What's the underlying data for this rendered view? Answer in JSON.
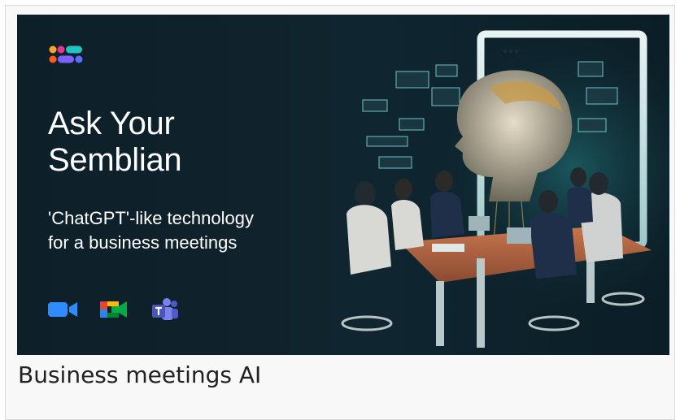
{
  "banner": {
    "title": "Ask Your\nSemblian",
    "subtitle": "'ChatGPT'-like technology\nfor a business meetings",
    "logo_icon": "semblian-logo-icon",
    "apps": [
      {
        "name": "Zoom",
        "icon": "zoom-icon",
        "color": "#2d8cff"
      },
      {
        "name": "Google Meet",
        "icon": "google-meet-icon",
        "color": "#00ac47"
      },
      {
        "name": "Microsoft Teams",
        "icon": "teams-icon",
        "color": "#5b5fc7"
      }
    ]
  },
  "caption": "Business meetings AI",
  "colors": {
    "banner_bg": "#0f222c",
    "accent_teal": "#3ec6c6",
    "text": "#ffffff"
  }
}
